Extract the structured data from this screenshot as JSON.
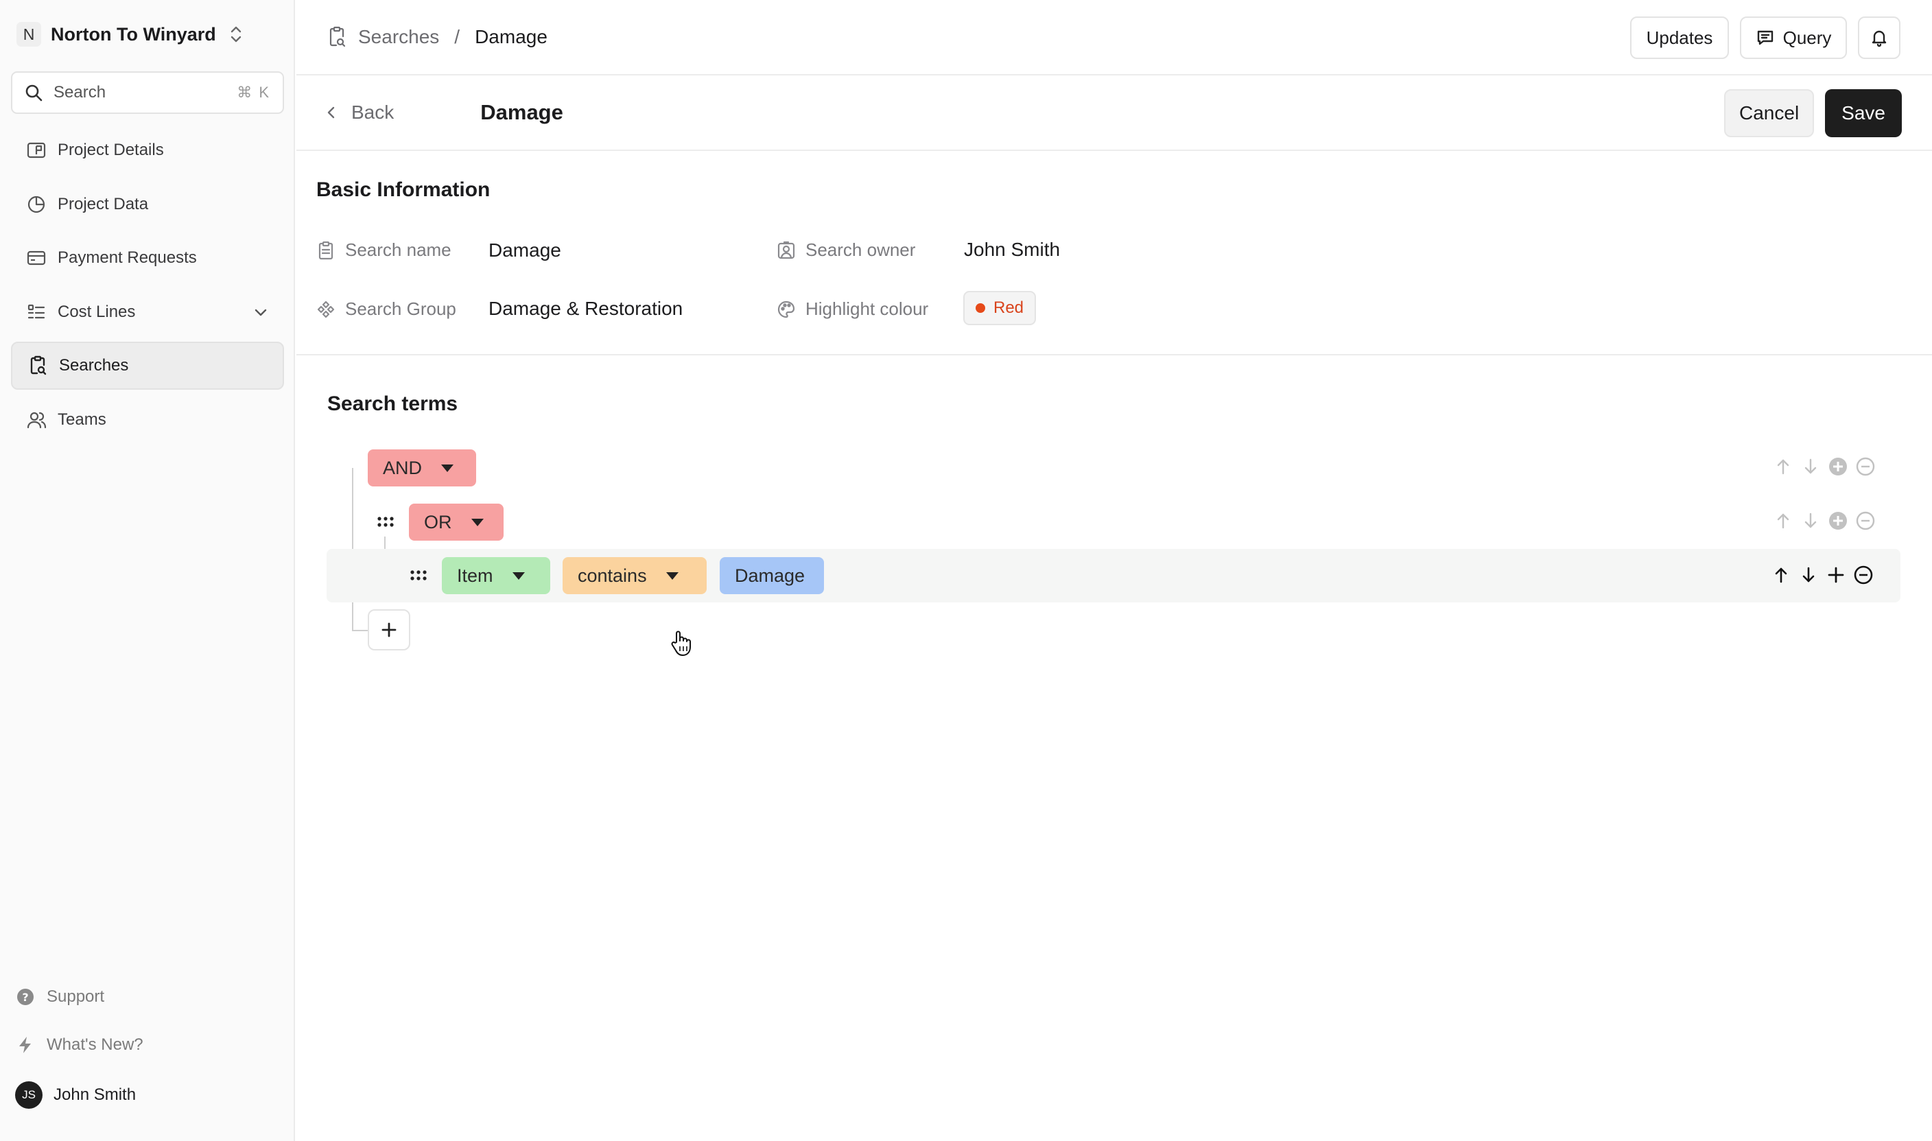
{
  "org": {
    "initial": "N",
    "name": "Norton To Winyard"
  },
  "sidebar": {
    "search_label": "Search",
    "search_shortcut": "⌘ K",
    "items": [
      {
        "label": "Project Details",
        "icon": "flag-board-icon"
      },
      {
        "label": "Project Data",
        "icon": "pie-chart-icon"
      },
      {
        "label": "Payment Requests",
        "icon": "credit-card-icon"
      },
      {
        "label": "Cost Lines",
        "icon": "list-checks-icon",
        "expandable": true
      },
      {
        "label": "Searches",
        "icon": "clipboard-search-icon",
        "active": true
      },
      {
        "label": "Teams",
        "icon": "users-icon"
      }
    ],
    "footer": {
      "support": "Support",
      "whats_new": "What's New?",
      "user_initials": "JS",
      "user_name": "John Smith"
    }
  },
  "topbar": {
    "breadcrumb_parent": "Searches",
    "breadcrumb_sep": "/",
    "breadcrumb_current": "Damage",
    "updates_label": "Updates",
    "query_label": "Query"
  },
  "header": {
    "back_label": "Back",
    "title": "Damage",
    "cancel_label": "Cancel",
    "save_label": "Save"
  },
  "basic": {
    "title": "Basic Information",
    "search_name_label": "Search name",
    "search_name_value": "Damage",
    "search_owner_label": "Search owner",
    "search_owner_value": "John Smith",
    "search_group_label": "Search Group",
    "search_group_value": "Damage & Restoration",
    "highlight_label": "Highlight colour",
    "highlight_value": "Red",
    "highlight_color": "#e64a19"
  },
  "terms": {
    "title": "Search terms",
    "root_operator": "AND",
    "group_operator": "OR",
    "rule_field": "Item",
    "rule_operator": "contains",
    "rule_value": "Damage"
  },
  "colors": {
    "operator_pill": "#f7a1a1",
    "field_pill": "#b4eab6",
    "op_pill": "#fbd39e",
    "value_pill": "#a6c6f7",
    "primary_button": "#1e1e1e"
  }
}
